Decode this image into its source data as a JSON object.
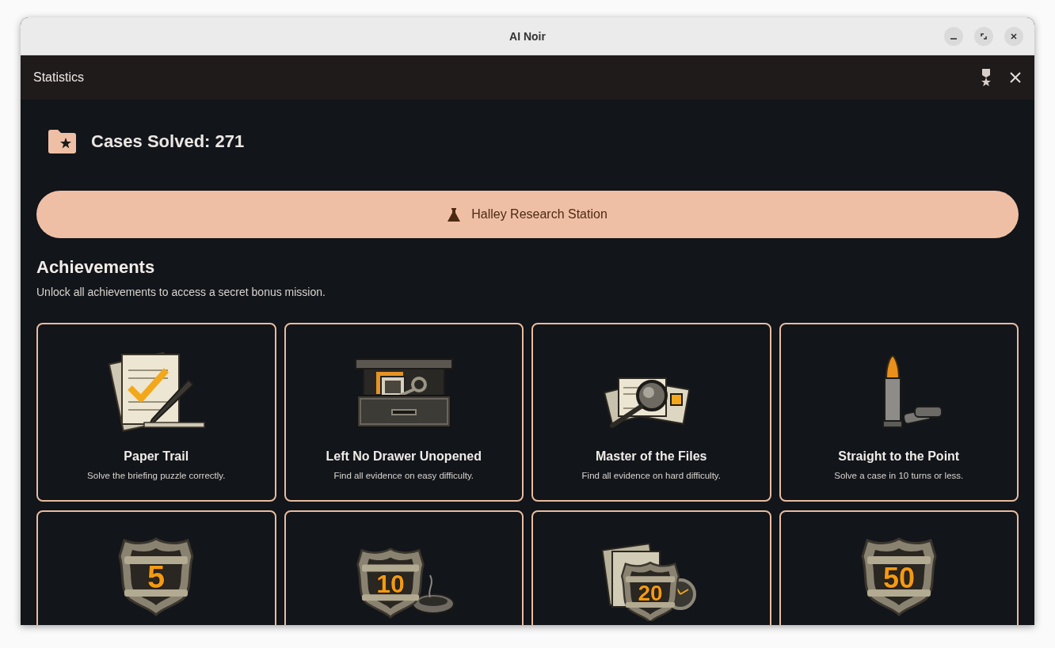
{
  "window": {
    "title": "AI Noir"
  },
  "header": {
    "title": "Statistics"
  },
  "cases_solved": "Cases Solved: 271",
  "location_button": "Halley Research Station",
  "achievements": {
    "title": "Achievements",
    "subtitle": "Unlock all achievements to access a secret bonus mission.",
    "items": [
      {
        "kind": "papers",
        "title": "Paper Trail",
        "description": "Solve the briefing puzzle correctly."
      },
      {
        "kind": "drawer",
        "title": "Left No Drawer Unopened",
        "description": "Find all evidence on easy difficulty."
      },
      {
        "kind": "files",
        "title": "Master of the Files",
        "description": "Find all evidence on hard difficulty."
      },
      {
        "kind": "bullet",
        "title": "Straight to the Point",
        "description": "Solve a case in 10 turns or less."
      },
      {
        "kind": "badge",
        "number": "5"
      },
      {
        "kind": "badge-ashtray",
        "number": "10"
      },
      {
        "kind": "badge-watch",
        "number": "20"
      },
      {
        "kind": "badge",
        "number": "50"
      }
    ]
  }
}
